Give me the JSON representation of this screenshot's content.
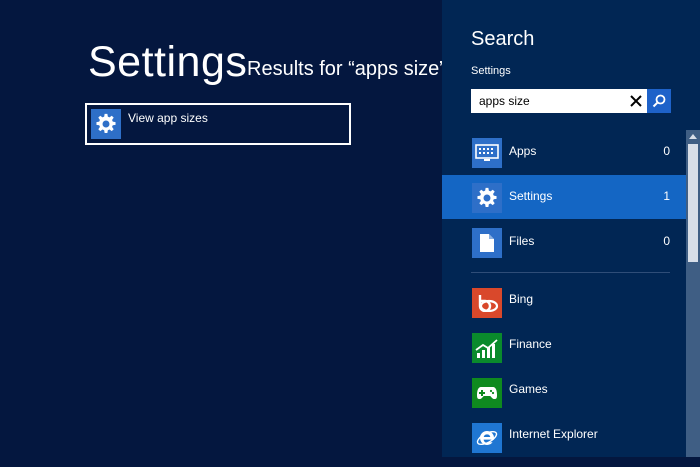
{
  "main": {
    "title": "Settings",
    "results_for": "Results for “apps size”",
    "results": [
      {
        "label": "View app sizes",
        "icon": "gear-icon"
      }
    ]
  },
  "search_pane": {
    "title": "Search",
    "scope": "Settings",
    "query": "apps size",
    "categories": [
      {
        "label": "Apps",
        "count": "0",
        "icon": "apps-keyboard-icon"
      },
      {
        "label": "Settings",
        "count": "1",
        "icon": "gear-icon",
        "selected": true
      },
      {
        "label": "Files",
        "count": "0",
        "icon": "file-icon"
      }
    ],
    "apps": [
      {
        "label": "Bing",
        "icon": "bing-icon",
        "color": "#d9482b"
      },
      {
        "label": "Finance",
        "icon": "finance-chart-icon",
        "color": "#0a8a2c"
      },
      {
        "label": "Games",
        "icon": "gamepad-icon",
        "color": "#0f8a1f"
      },
      {
        "label": "Internet Explorer",
        "icon": "internet-explorer-icon",
        "color": "#1f76d2"
      }
    ]
  },
  "colors": {
    "background": "#04173f",
    "pane_background": "#012654",
    "selection": "#1466c4",
    "tile_icon": "#2e6fc8"
  }
}
